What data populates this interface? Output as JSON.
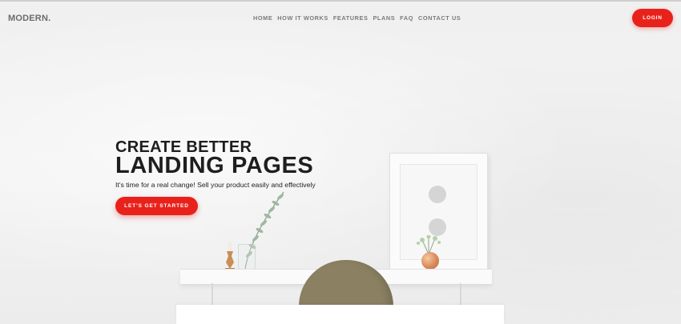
{
  "brand": {
    "logo": "MODERN."
  },
  "nav": {
    "links": [
      "HOME",
      "HOW IT WORKS",
      "FEATURES",
      "PLANS",
      "FAQ",
      "CONTACT US"
    ],
    "login_label": "LOGIN"
  },
  "hero": {
    "title_line1": "CREATE BETTER",
    "title_line2": "LANDING PAGES",
    "subtitle": "It's time for a real change! Sell your product easily and effectively",
    "cta_label": "LET'S GET STARTED"
  },
  "colors": {
    "accent": "#e8221b",
    "text_dark": "#1e1e1e",
    "nav_text": "#7a7a7a",
    "background": "#f0f0f0"
  }
}
